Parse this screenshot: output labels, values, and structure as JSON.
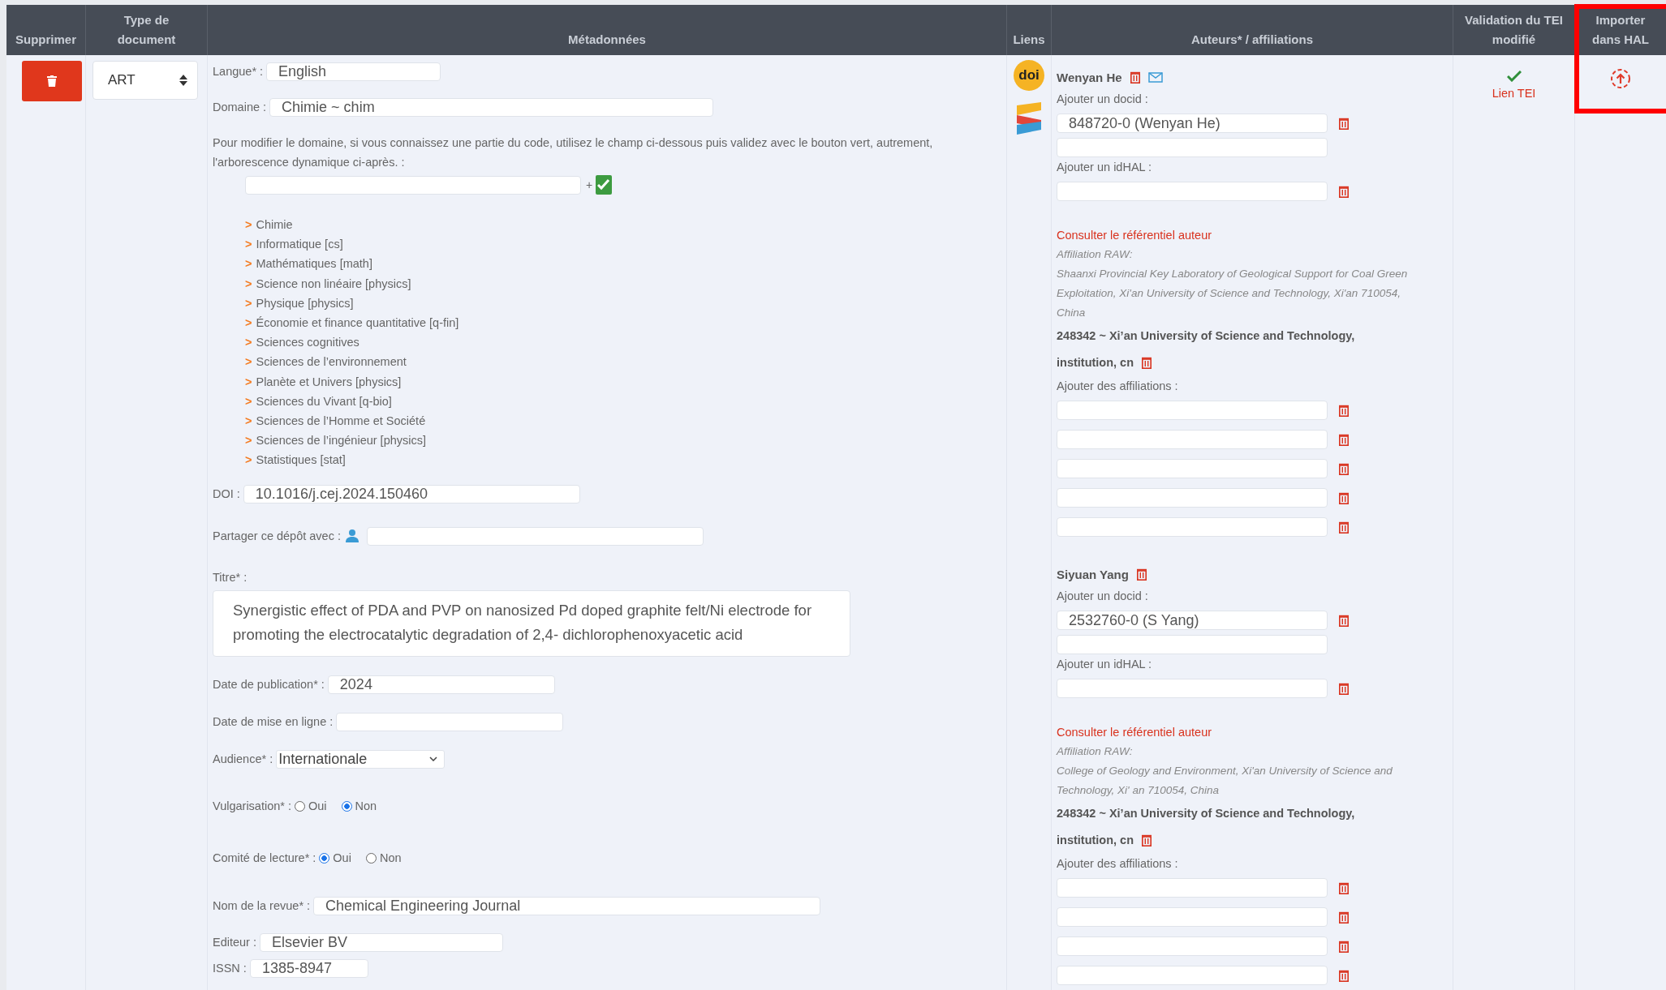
{
  "columns": [
    "Supprimer",
    "Type de document",
    "Métadonnées",
    "Liens",
    "Auteurs* / affiliations",
    "Validation du TEI modifié",
    "Importer dans HAL"
  ],
  "record": {
    "document_type": {
      "value": "ART"
    },
    "metadata": {
      "language": {
        "label": "Langue* :",
        "value": "English"
      },
      "domain": {
        "label": "Domaine :",
        "value": "Chimie ~ chim"
      },
      "domain_help": "Pour modifier le domaine, si vous connaissez une partie du code, utilisez le champ ci-dessous puis validez avec le bouton vert, autrement, l'arborescence dynamique ci-après. :",
      "domain_code": {
        "separator": "+"
      },
      "domain_tree": [
        {
          "marker": ">",
          "label": "Chimie"
        },
        {
          "marker": ">",
          "label": "Informatique [cs]"
        },
        {
          "marker": ">",
          "label": "Mathématiques [math]"
        },
        {
          "marker": ">",
          "label": "Science non linéaire [physics]"
        },
        {
          "marker": ">",
          "label": "Physique [physics]"
        },
        {
          "marker": ">",
          "label": "Économie et finance quantitative [q-fin]"
        },
        {
          "marker": ">",
          "label": "Sciences cognitives"
        },
        {
          "marker": ">",
          "label": "Sciences de l’environnement"
        },
        {
          "marker": ">",
          "label": "Planète et Univers [physics]"
        },
        {
          "marker": ">",
          "label": "Sciences du Vivant [q-bio]"
        },
        {
          "marker": ">",
          "label": "Sciences de l’Homme et Société"
        },
        {
          "marker": ">",
          "label": "Sciences de l’ingénieur [physics]"
        },
        {
          "marker": ">",
          "label": "Statistiques [stat]"
        }
      ],
      "doi": {
        "label": "DOI :",
        "value": "10.1016/j.cej.2024.150460"
      },
      "share": {
        "label": "Partager ce dépôt avec :"
      },
      "title": {
        "label": "Titre* :",
        "value": "Synergistic effect of PDA and PVP on nanosized Pd doped graphite felt/Ni electrode for promoting the electrocatalytic degradation of 2,4- dichlorophenoxyacetic acid"
      },
      "publication_date": {
        "label": "Date de publication* :",
        "value": "2024"
      },
      "online_date": {
        "label": "Date de mise en ligne :"
      },
      "audience": {
        "label": "Audience* :",
        "value": "Internationale"
      },
      "popularization": {
        "label": "Vulgarisation* :",
        "options": [
          {
            "label": "Oui",
            "selected": false
          },
          {
            "label": "Non",
            "selected": true
          }
        ]
      },
      "peer_review": {
        "label": "Comité de lecture* :",
        "options": [
          {
            "label": "Oui",
            "selected": true
          },
          {
            "label": "Non",
            "selected": false
          }
        ]
      },
      "journal": {
        "label": "Nom de la revue* :",
        "value": "Chemical Engineering Journal"
      },
      "publisher": {
        "label": "Editeur :",
        "value": "Elsevier BV"
      },
      "issn": {
        "label": "ISSN :",
        "value": "1385-8947"
      }
    },
    "links": [
      {
        "kind": "doi",
        "label": "doi"
      },
      {
        "kind": "hal"
      }
    ],
    "authors": [
      {
        "name": "Wenyan He",
        "email": true,
        "docid_label": "Ajouter un docid :",
        "docid": "848720-0 (Wenyan He)",
        "idhal_label": "Ajouter un idHAL :",
        "referential_link": "Consulter le référentiel auteur",
        "raw_label": "Affiliation RAW:",
        "raw": "Shaanxi Provincial Key Laboratory of Geological Support for Coal Green Exploitation, Xi'an University of Science and Technology, Xi'an 710054, China",
        "affiliation_line1": "248342 ~ Xi’an University of Science and Technology,",
        "affiliation_line2": "institution, cn",
        "add_affiliations_label": "Ajouter des affiliations :"
      },
      {
        "name": "Siyuan Yang",
        "email": false,
        "docid_label": "Ajouter un docid :",
        "docid": "2532760-0 (S Yang)",
        "idhal_label": "Ajouter un idHAL :",
        "referential_link": "Consulter le référentiel auteur",
        "raw_label": "Affiliation RAW:",
        "raw": "College of Geology and Environment, Xi'an University of Science and Technology, Xi' an 710054, China",
        "affiliation_line1": "248342 ~ Xi’an University of Science and Technology,",
        "affiliation_line2": "institution, cn",
        "add_affiliations_label": "Ajouter des affiliations :"
      }
    ],
    "validation": {
      "checked": true,
      "link": "Lien TEI"
    }
  }
}
